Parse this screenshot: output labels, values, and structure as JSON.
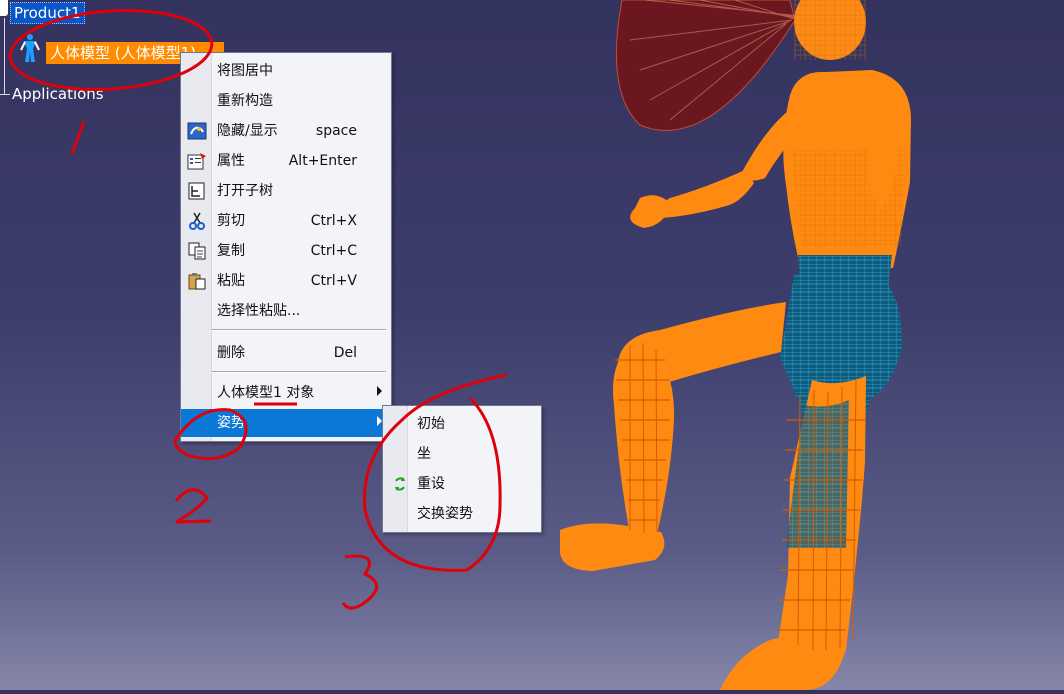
{
  "tree": {
    "product": "Product1",
    "manikin": "人体模型 (人体模型1)",
    "applications": "Applications"
  },
  "context_menu": {
    "items": [
      {
        "label": "将图居中",
        "shortcut": ""
      },
      {
        "label": "重新构造",
        "shortcut": ""
      },
      {
        "label": "隐藏/显示",
        "shortcut": "space"
      },
      {
        "label": "属性",
        "shortcut": "Alt+Enter"
      },
      {
        "label": "打开子树",
        "shortcut": ""
      },
      {
        "label": "剪切",
        "shortcut": "Ctrl+X"
      },
      {
        "label": "复制",
        "shortcut": "Ctrl+C"
      },
      {
        "label": "粘贴",
        "shortcut": "Ctrl+V"
      },
      {
        "label": "选择性粘贴...",
        "shortcut": ""
      },
      {
        "label": "删除",
        "shortcut": "Del"
      },
      {
        "label": "人体模型1 对象",
        "shortcut": ""
      },
      {
        "label": "姿势",
        "shortcut": ""
      }
    ],
    "selected_item": "姿势"
  },
  "submenu": {
    "items": [
      {
        "label": "初始"
      },
      {
        "label": "坐"
      },
      {
        "label": "重设"
      },
      {
        "label": "交换姿势"
      }
    ]
  },
  "annotations": {
    "step1": "1",
    "step2": "2",
    "step3": "3"
  },
  "colors": {
    "selection_blue": "#0b78d7",
    "manikin_orange": "#ff8c00",
    "annotation_red": "#e0000a",
    "background": "#3d3d6c"
  }
}
